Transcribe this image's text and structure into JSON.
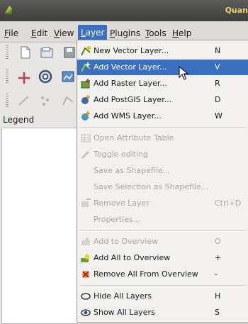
{
  "window": {
    "title": "Quan"
  },
  "menubar": {
    "items": [
      {
        "mnemonic": "F",
        "rest": "ile"
      },
      {
        "mnemonic": "E",
        "rest": "dit"
      },
      {
        "mnemonic": "V",
        "rest": "iew"
      },
      {
        "mnemonic": "L",
        "rest": "ayer"
      },
      {
        "mnemonic": "P",
        "rest": "lugins"
      },
      {
        "mnemonic": "T",
        "rest": "ools"
      },
      {
        "mnemonic": "H",
        "rest": "elp"
      }
    ]
  },
  "legend": {
    "label": "Legend"
  },
  "layer_menu": {
    "items": [
      {
        "label": "New Vector Layer...",
        "shortcut": "N",
        "icon": "new-vector-layer-icon",
        "state": "enabled"
      },
      {
        "label": "Add Vector Layer...",
        "shortcut": "V",
        "icon": "add-vector-layer-icon",
        "state": "highlighted"
      },
      {
        "label": "Add Raster Layer...",
        "shortcut": "R",
        "icon": "add-raster-layer-icon",
        "state": "enabled"
      },
      {
        "label": "Add PostGIS Layer...",
        "shortcut": "D",
        "icon": "add-postgis-layer-icon",
        "state": "enabled"
      },
      {
        "label": "Add WMS Layer...",
        "shortcut": "W",
        "icon": "add-wms-layer-icon",
        "state": "enabled"
      },
      {
        "label": "Open Attribute Table",
        "shortcut": "",
        "icon": "attribute-table-icon",
        "state": "disabled"
      },
      {
        "label": "Toggle editing",
        "shortcut": "",
        "icon": "pencil-icon",
        "state": "disabled"
      },
      {
        "label": "Save as Shapefile...",
        "shortcut": "",
        "icon": "",
        "state": "disabled"
      },
      {
        "label": "Save Selection as Shapefile...",
        "shortcut": "",
        "icon": "",
        "state": "disabled"
      },
      {
        "label": "Remove Layer",
        "shortcut": "Ctrl+D",
        "icon": "remove-layer-icon",
        "state": "disabled"
      },
      {
        "label": "Properties...",
        "shortcut": "",
        "icon": "",
        "state": "disabled"
      },
      {
        "label": "Add to Overview",
        "shortcut": "O",
        "icon": "add-to-overview-icon",
        "state": "disabled"
      },
      {
        "label": "Add All to Overview",
        "shortcut": "+",
        "icon": "add-all-to-overview-icon",
        "state": "enabled"
      },
      {
        "label": "Remove All From Overview",
        "shortcut": "-",
        "icon": "remove-all-from-overview-icon",
        "state": "enabled"
      },
      {
        "label": "Hide All Layers",
        "shortcut": "H",
        "icon": "hide-all-layers-icon",
        "state": "enabled"
      },
      {
        "label": "Show All Layers",
        "shortcut": "S",
        "icon": "show-all-layers-icon",
        "state": "enabled"
      }
    ]
  },
  "colors": {
    "accent": "#3a70bf",
    "disabled_text": "#a9a7a3",
    "title_text": "#f0d070"
  }
}
